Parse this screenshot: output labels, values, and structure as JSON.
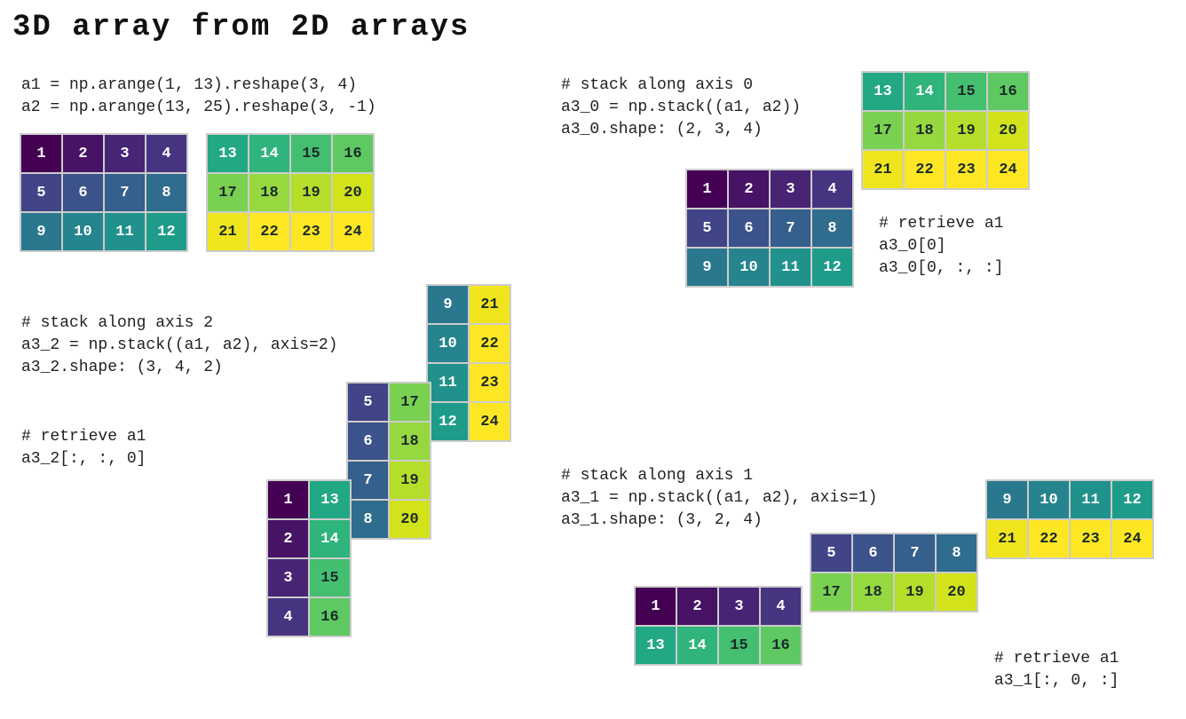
{
  "title": "3D array from 2D arrays",
  "colormap": [
    "#440154",
    "#471365",
    "#482475",
    "#463480",
    "#414487",
    "#3b528b",
    "#355f8d",
    "#2f6c8e",
    "#2a788e",
    "#25848e",
    "#21918c",
    "#1e9c89",
    "#22a884",
    "#2fb47c",
    "#44bf70",
    "#5ec962",
    "#7ad151",
    "#95d840",
    "#b5de2b",
    "#d2e21b",
    "#f0e51d",
    "#fde725",
    "#fde725",
    "#fde725"
  ],
  "a1": [
    [
      1,
      2,
      3,
      4
    ],
    [
      5,
      6,
      7,
      8
    ],
    [
      9,
      10,
      11,
      12
    ]
  ],
  "a2": [
    [
      13,
      14,
      15,
      16
    ],
    [
      17,
      18,
      19,
      20
    ],
    [
      21,
      22,
      23,
      24
    ]
  ],
  "code": {
    "defs": "a1 = np.arange(1, 13).reshape(3, 4)\na2 = np.arange(13, 25).reshape(3, -1)",
    "axis0": "# stack along axis 0\na3_0 = np.stack((a1, a2))\na3_0.shape: (2, 3, 4)",
    "axis0_retrieve": "# retrieve a1\na3_0[0]\na3_0[0, :, :]",
    "axis2": "# stack along axis 2\na3_2 = np.stack((a1, a2), axis=2)\na3_2.shape: (3, 4, 2)",
    "axis2_retrieve": "# retrieve a1\na3_2[:, :, 0]",
    "axis1": "# stack along axis 1\na3_1 = np.stack((a1, a2), axis=1)\na3_1.shape: (3, 2, 4)",
    "axis1_retrieve": "# retrieve a1\na3_1[:, 0, :]"
  },
  "axis2": {
    "slice0": [
      [
        1,
        13
      ],
      [
        2,
        14
      ],
      [
        3,
        15
      ],
      [
        4,
        16
      ]
    ],
    "slice1": [
      [
        5,
        17
      ],
      [
        6,
        18
      ],
      [
        7,
        19
      ],
      [
        8,
        20
      ]
    ],
    "slice2": [
      [
        9,
        21
      ],
      [
        10,
        22
      ],
      [
        11,
        23
      ],
      [
        12,
        24
      ]
    ]
  },
  "axis1": {
    "slice0": [
      [
        1,
        2,
        3,
        4
      ],
      [
        13,
        14,
        15,
        16
      ]
    ],
    "slice1": [
      [
        5,
        6,
        7,
        8
      ],
      [
        17,
        18,
        19,
        20
      ]
    ],
    "slice2": [
      [
        9,
        10,
        11,
        12
      ],
      [
        21,
        22,
        23,
        24
      ]
    ]
  }
}
